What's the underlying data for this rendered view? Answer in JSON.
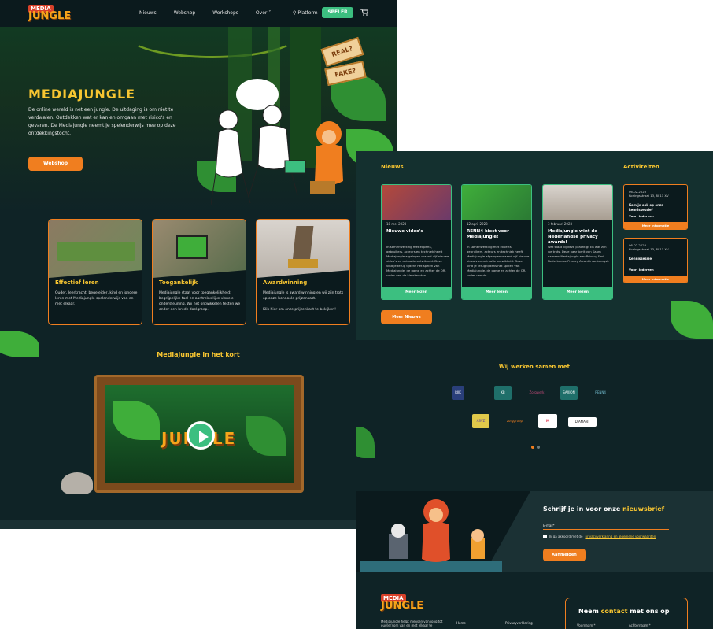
{
  "left": {
    "logo": {
      "top": "MEDIA",
      "main": "JUNGLE"
    },
    "nav": {
      "items": [
        "Nieuws",
        "Webshop",
        "Workshops",
        "Over"
      ],
      "platform": "Platform",
      "speler": "SPELER"
    },
    "hero": {
      "title": "MEDIAJUNGLE",
      "text": "De online wereld is net een jungle. De uitdaging is om niet te verdwalen. Ontdekken wat er kan en omgaan met risico's en gevaren. De Mediajungle neemt je spelenderwijs mee op deze ontdekkingstocht.",
      "button": "Webshop",
      "signs": [
        "REAL?",
        "FAKE?"
      ]
    },
    "cards": [
      {
        "title": "Effectief leren",
        "text": "Ouder, leerkracht, begeleider, kind en jongere leren met Mediajungle spelenderwijs van en met elkaar."
      },
      {
        "title": "Toegankelijk",
        "text": "Mediajungle staat voor toegankelijkheid: begrijpelijke taal en aantrekkelijke visuele ondersteuning. Wij het ontwikkelen testen we onder een brede doelgroep."
      },
      {
        "title": "Awardwinning",
        "text": "Mediajungle is award winning en wij zijn trots op onze bonnoole prijzenkast.",
        "link": "Klik hier om onze prijzenkast te bekijken!"
      }
    ],
    "video": {
      "title": "Mediajungle in het kort",
      "logo": "JUNGLE"
    }
  },
  "right": {
    "news": {
      "title": "Nieuws",
      "items": [
        {
          "date": "18 mei 2023",
          "title": "Nieuwe video's",
          "text": "In samenwerking met experts, gebruikers, acteurs en techniek heeft Mediajungle afgelopen maand vijf nieuwe video's en animatie ontwikkeld. Deze vind je terug tijdens het spelen van Mediajungle, de game en achter de QR-codes van de kletskaarten.",
          "button": "Meer lezen"
        },
        {
          "date": "12 april 2023",
          "title": "RENN4 kiest voor Mediajungle!",
          "text": "In samenwerking met experts, gebruikers, acteurs en techniek heeft Mediajungle afgelopen maand vijf nieuwe video's en animatie ontwikkeld. Deze vind je terug tijdens het spelen van Mediajungle, de game en achter de QR-codes van de...",
          "button": "Meer lezen"
        },
        {
          "date": "3 februari 2023",
          "title": "Mediajungle wint de Nederlandse privacy awards!",
          "text": "Wat staat bij deze prachtig! En wat zijn we trots. Deze naar Jorrit van Kaam namens Mediajungle een Privacy First Nederlandse Privacy Award in ontvangst.",
          "button": "Meer lezen"
        }
      ],
      "more": "Meer Nieuws"
    },
    "activities": {
      "title": "Activiteiten",
      "items": [
        {
          "date": "06-02-2023",
          "place": "Koningsstraat 13, 8011 XV",
          "title": "Kom je ook op onze kennissessie?",
          "audience": "Voor: Iedereen",
          "button": "Meer informatie"
        },
        {
          "date": "06-02-2023",
          "place": "Koningsstraat 13, 8011 XV",
          "title": "Kennissessie",
          "audience": "Voor: Iedereen",
          "button": "Meer informatie"
        }
      ]
    },
    "partners": {
      "title": "Wij werken samen met",
      "logos": [
        "RIJK",
        "KB",
        "Zorgwerk",
        "SAXION",
        "RENN4",
        "ASVZ",
        "zorggroep",
        "M",
        "DIAMANT"
      ]
    },
    "newsletter": {
      "title_a": "Schrijf je in voor onze ",
      "title_b": "nieuwsbrief",
      "label": "E-mail*",
      "check": "Ik ga akkoord met de ",
      "check_link": "privacyverklaring en algemene voorwaarden",
      "button": "Aanmelden"
    },
    "footer": {
      "text": "Mediajungle helpt mensen van jong tot oud(er) om van en met elkaar te",
      "col1": "Home",
      "col2": "Privacyverklaring",
      "contact_a": "Neem ",
      "contact_b": "contact",
      "contact_c": " met ons op",
      "field1": "Voornaam *",
      "field2": "Achternaam *"
    }
  }
}
